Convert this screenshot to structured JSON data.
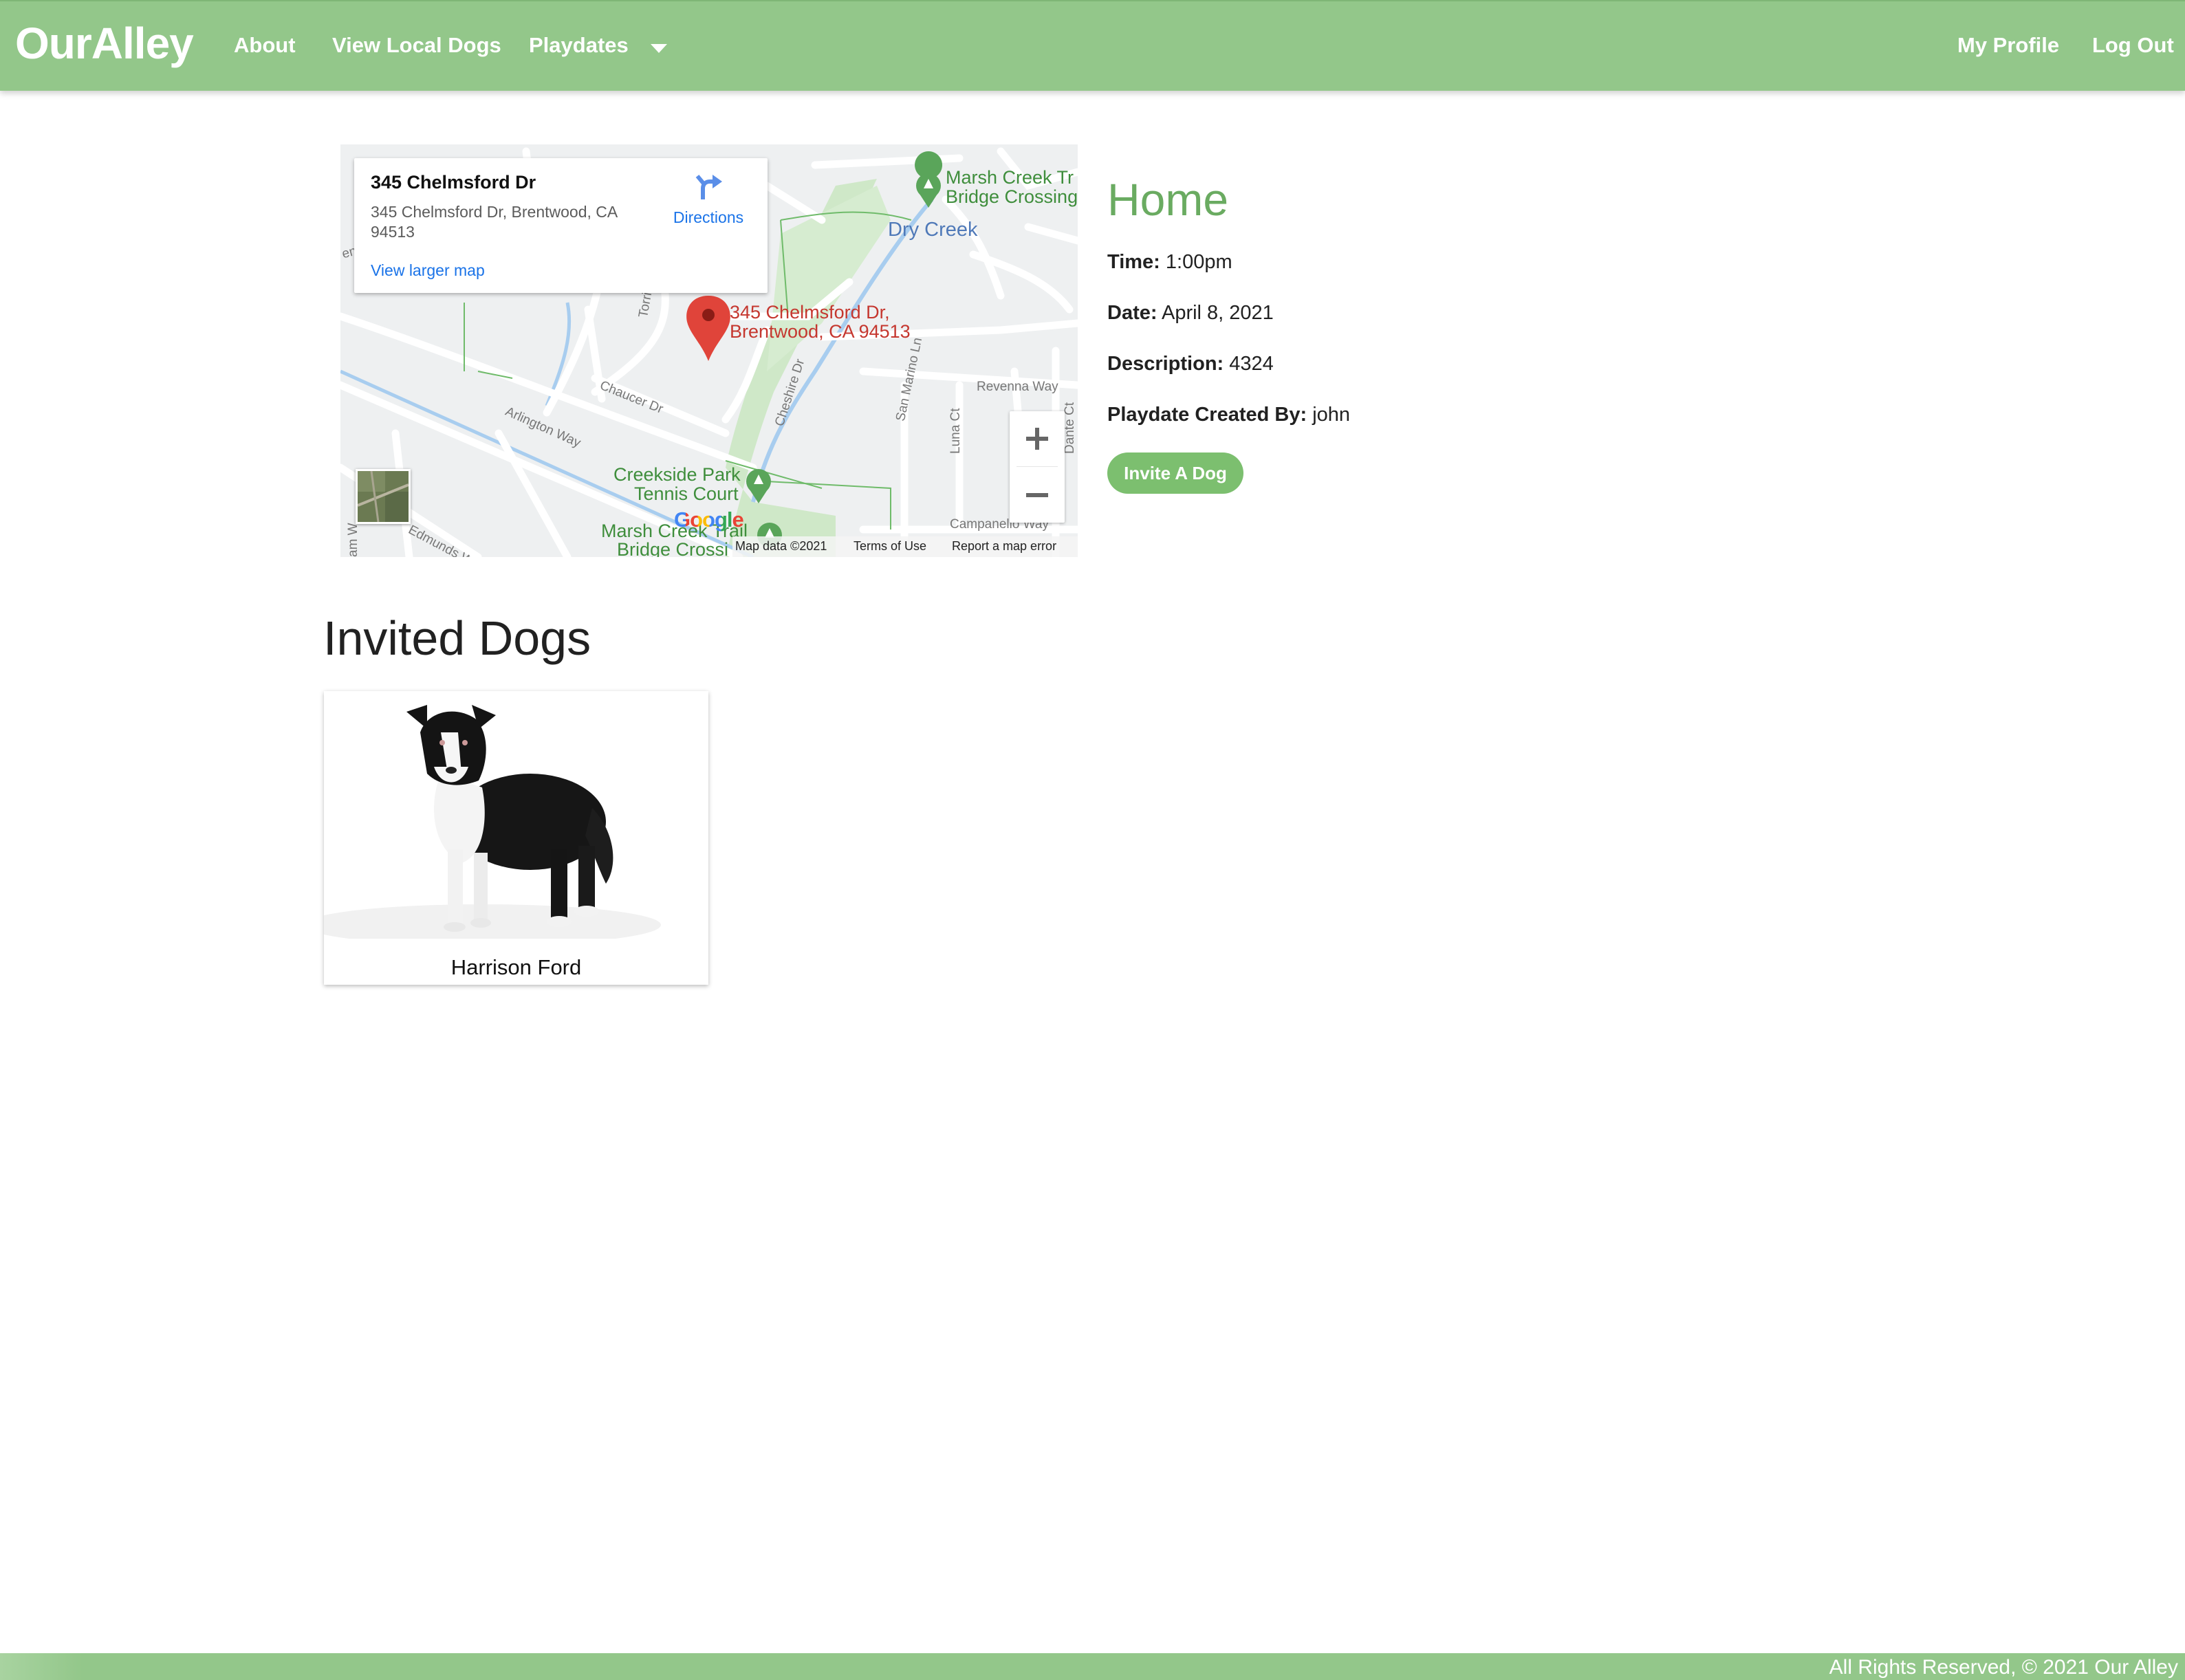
{
  "navbar": {
    "brand": "OurAlley",
    "links": {
      "about": "About",
      "view_local_dogs": "View Local Dogs",
      "playdates": "Playdates",
      "my_profile": "My Profile",
      "log_out": "Log Out"
    },
    "color": "#93c78a"
  },
  "map": {
    "info_card": {
      "title": "345 Chelmsford Dr",
      "address": "345 Chelmsford Dr, Brentwood, CA 94513",
      "directions_label": "Directions",
      "view_larger_map": "View larger map"
    },
    "marker_label_line1": "345 Chelmsford Dr,",
    "marker_label_line2": "Brentwood, CA 94513",
    "places": {
      "marsh_creek_top_1": "Marsh Creek Tr",
      "marsh_creek_top_2": "Bridge Crossing",
      "dry_creek": "Dry Creek",
      "creekside_1": "Creekside Park",
      "creekside_2": "Tennis Court",
      "marsh_creek_bottom_1": "Marsh Creek Trail",
      "marsh_creek_bottom_2": "Bridge Crossi"
    },
    "streets": {
      "torrington": "Torrington Dr",
      "chaucer": "Chaucer Dr",
      "arlington": "Arlington Way",
      "cheshire": "Cheshire Dr",
      "san_marino": "San Marino Ln",
      "luna": "Luna Ct",
      "revenna": "Revenna Way",
      "dante": "Dante Ct",
      "campanello": "Campanello Way",
      "edmunds": "Edmunds W",
      "william": "am W",
      "en": "en"
    },
    "google_logo": "Google",
    "attribution": {
      "map_data": "Map data ©2021",
      "terms": "Terms of Use",
      "report": "Report a map error"
    }
  },
  "playdate": {
    "title": "Home",
    "time_label": "Time:",
    "time_value": "1:00pm",
    "date_label": "Date:",
    "date_value": "April 8, 2021",
    "description_label": "Description:",
    "description_value": "4324",
    "created_by_label": "Playdate Created By:",
    "created_by_value": "john",
    "invite_button": "Invite A Dog",
    "title_color": "#6aab61",
    "button_color": "#7cbf6f"
  },
  "invited": {
    "heading": "Invited Dogs",
    "dogs": [
      {
        "name": "Harrison Ford"
      }
    ]
  },
  "footer": {
    "text": "All Rights Reserved, © 2021 Our Alley"
  }
}
